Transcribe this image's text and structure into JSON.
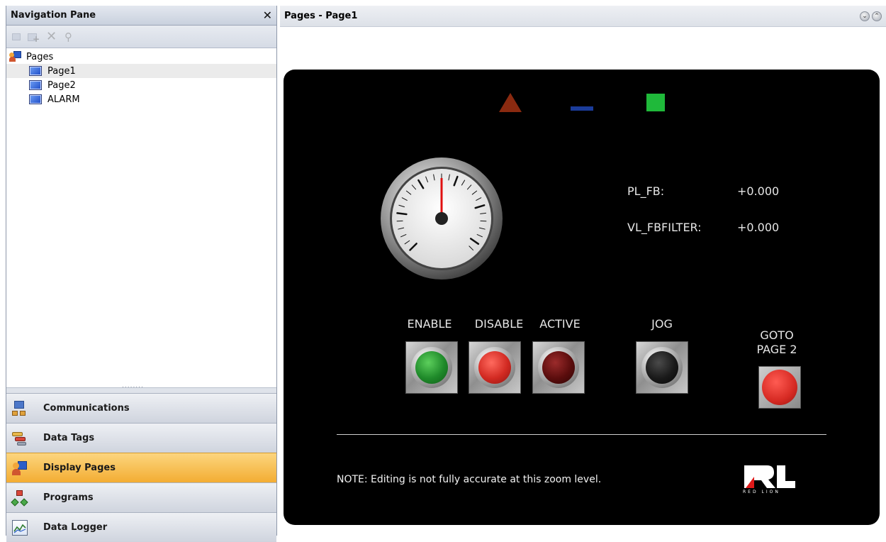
{
  "nav": {
    "title": "Navigation Pane",
    "close_glyph": "✕",
    "toolbar": [
      "page-icon",
      "add-page-icon",
      "delete-icon",
      "find-icon"
    ],
    "tree": {
      "root": "Pages",
      "items": [
        {
          "label": "Page1",
          "selected": true
        },
        {
          "label": "Page2",
          "selected": false
        },
        {
          "label": "ALARM",
          "selected": false
        }
      ]
    },
    "categories": [
      {
        "label": "Communications",
        "icon": "communications-icon",
        "active": false
      },
      {
        "label": "Data Tags",
        "icon": "data-tags-icon",
        "active": false
      },
      {
        "label": "Display Pages",
        "icon": "display-pages-icon",
        "active": true
      },
      {
        "label": "Programs",
        "icon": "programs-icon",
        "active": false
      },
      {
        "label": "Data Logger",
        "icon": "data-logger-icon",
        "active": false
      }
    ]
  },
  "page": {
    "title": "Pages - Page1",
    "tags": [
      {
        "label": "PL_FB:",
        "value": "+0.000"
      },
      {
        "label": "VL_FBFILTER:",
        "value": "+0.000"
      }
    ],
    "buttons": [
      {
        "label": "ENABLE",
        "color": "green"
      },
      {
        "label": "DISABLE",
        "color": "red"
      },
      {
        "label": "ACTIVE",
        "color": "darkred"
      },
      {
        "label": "JOG",
        "color": "black"
      }
    ],
    "goto": {
      "line1": "GOTO",
      "line2": "PAGE 2"
    },
    "note": "NOTE: Editing is not fully accurate at this zoom level.",
    "logo_text": "RED LION",
    "colors": {
      "triangle": "#8a2a10",
      "dash": "#1b3c9a",
      "square": "#1fb93a",
      "needle": "#e01010",
      "active_category": "#f3ad33"
    }
  }
}
